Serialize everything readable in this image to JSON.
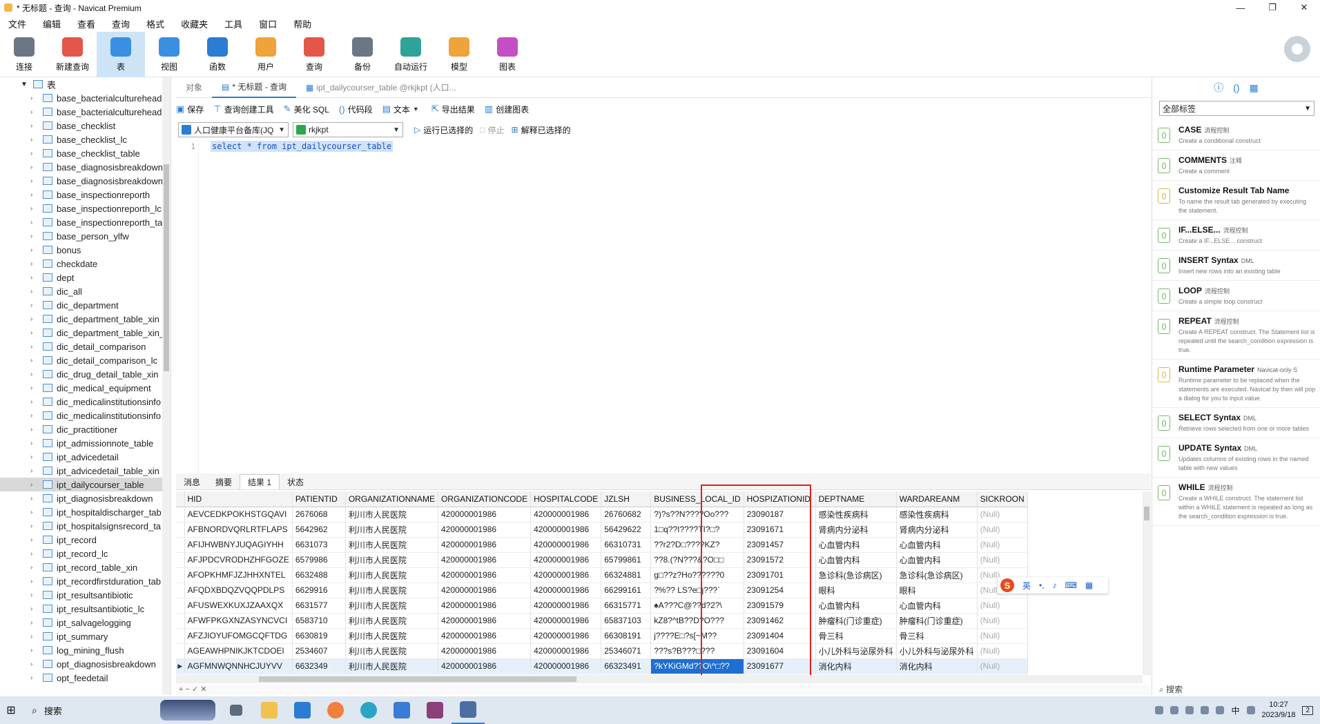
{
  "window": {
    "title": "* 无标题 - 查询 - Navicat Premium"
  },
  "menu": [
    "文件",
    "编辑",
    "查看",
    "查询",
    "格式",
    "收藏夹",
    "工具",
    "窗口",
    "帮助"
  ],
  "ribbon": [
    {
      "label": "连接",
      "icon": "plug-icon",
      "color": "#6b7785"
    },
    {
      "label": "新建查询",
      "icon": "new-query-icon",
      "color": "#e3564a"
    },
    {
      "label": "表",
      "icon": "table-icon",
      "color": "#3b8fe0"
    },
    {
      "label": "视图",
      "icon": "view-icon",
      "color": "#3b8fe0"
    },
    {
      "label": "函数",
      "icon": "function-icon",
      "color": "#2b7cd3"
    },
    {
      "label": "用户",
      "icon": "user-icon",
      "color": "#f0a23b"
    },
    {
      "label": "查询",
      "icon": "query-icon",
      "color": "#e3564a"
    },
    {
      "label": "备份",
      "icon": "backup-icon",
      "color": "#6b7785"
    },
    {
      "label": "自动运行",
      "icon": "robot-icon",
      "color": "#2fa39a"
    },
    {
      "label": "模型",
      "icon": "model-icon",
      "color": "#f0a23b"
    },
    {
      "label": "图表",
      "icon": "chart-icon",
      "color": "#c44fc4"
    }
  ],
  "sidebar": {
    "root": "表",
    "items": [
      "base_bacterialculturehead",
      "base_bacterialculturehead",
      "base_checklist",
      "base_checklist_lc",
      "base_checklist_table",
      "base_diagnosisbreakdown",
      "base_diagnosisbreakdown",
      "base_inspectionreporth",
      "base_inspectionreporth_lc",
      "base_inspectionreporth_ta",
      "base_person_ylfw",
      "bonus",
      "checkdate",
      "dept",
      "dic_all",
      "dic_department",
      "dic_department_table_xin",
      "dic_department_table_xin_",
      "dic_detail_comparison",
      "dic_detail_comparison_lc",
      "dic_drug_detail_table_xin",
      "dic_medical_equipment",
      "dic_medicalinstitutionsinfo",
      "dic_medicalinstitutionsinfo",
      "dic_practitioner",
      "ipt_admissionnote_table",
      "ipt_advicedetail",
      "ipt_advicedetail_table_xin",
      "ipt_dailycourser_table",
      "ipt_diagnosisbreakdown",
      "ipt_hospitaldischarger_tab",
      "ipt_hospitalsignsrecord_ta",
      "ipt_record",
      "ipt_record_lc",
      "ipt_record_table_xin",
      "ipt_recordfirstduration_tab",
      "ipt_resultsantibiotic",
      "ipt_resultsantibiotic_lc",
      "ipt_salvagelogging",
      "ipt_summary",
      "log_mining_flush",
      "opt_diagnosisbreakdown",
      "opt_feedetail"
    ],
    "selected_index": 28
  },
  "tabs": {
    "objects": "对象",
    "active": "* 无标题 - 查询",
    "other": "ipt_dailycourser_table @rkjkpt (人口..."
  },
  "toolbar1": {
    "save": "保存",
    "query_builder": "查询创建工具",
    "beautify": "美化 SQL",
    "snippet": "代码段",
    "text": "文本",
    "export": "导出结果",
    "create_chart": "创建图表"
  },
  "toolbar2": {
    "connection": "人口健康平台备库(JQ",
    "database": "rkjkpt",
    "run_selected": "运行已选择的",
    "stop": "停止",
    "explain": "解释已选择的"
  },
  "editor": {
    "line_number": "1",
    "sql": "select * from ipt_dailycourser_table"
  },
  "result_tabs": [
    "消息",
    "摘要",
    "结果 1",
    "状态"
  ],
  "grid": {
    "columns": [
      "HID",
      "PATIENTID",
      "ORGANIZATIONNAME",
      "ORGANIZATIONCODE",
      "HOSPITALCODE",
      "JZLSH",
      "BUSINESS_LOCAL_ID",
      "HOSPIZATIONID",
      "DEPTNAME",
      "WARDAREANM",
      "SICKROON"
    ],
    "rows": [
      [
        "AEVCEDKPOKHSTGQAVI",
        "2676068",
        "利川市人民医院",
        "420000001986",
        "420000001986",
        "26760682",
        "?)?s??N????Oo???",
        "23090187",
        "感染性疾病科",
        "感染性疾病科",
        "(Null)"
      ],
      [
        "AFBNORDVQRLRTFLAPS",
        "5642962",
        "利川市人民医院",
        "420000001986",
        "420000001986",
        "56429622",
        "1□q??I????TI?□?",
        "23091671",
        "肾病内分泌科",
        "肾病内分泌科",
        "(Null)"
      ],
      [
        "AFIJHWBNYJUQAGIYHH",
        "6631073",
        "利川市人民医院",
        "420000001986",
        "420000001986",
        "66310731",
        "??r2?D□????KZ?",
        "23091457",
        "心血管内科",
        "心血管内科",
        "(Null)"
      ],
      [
        "AFJPDCVRODHZHFGOZE",
        "6579986",
        "利川市人民医院",
        "420000001986",
        "420000001986",
        "65799861",
        "??8.(?N???&?O□□",
        "23091572",
        "心血管内科",
        "心血管内科",
        "(Null)"
      ],
      [
        "AFOPKHMFJZJHHXNTEL",
        "6632488",
        "利川市人民医院",
        "420000001986",
        "420000001986",
        "66324881",
        "g□??z?Ho??????0",
        "23091701",
        "急诊科(急诊病区)",
        "急诊科(急诊病区)",
        "(Null)"
      ],
      [
        "AFQDXBDQZVQQPDLPS",
        "6629916",
        "利川市人民医院",
        "420000001986",
        "420000001986",
        "66299161",
        "?%?? LS?e□j???`",
        "23091254",
        "眼科",
        "眼科",
        "(Null)"
      ],
      [
        "AFUSWEXKUXJZAAXQX",
        "6631577",
        "利川市人民医院",
        "420000001986",
        "420000001986",
        "66315771",
        "♠A???C@??d?2?\\",
        "23091579",
        "心血管内科",
        "心血管内科",
        "(Null)"
      ],
      [
        "AFWFPKGXNZASYNCVCI",
        "6583710",
        "利川市人民医院",
        "420000001986",
        "420000001986",
        "65837103",
        "kZ8?^tB??D?O???",
        "23091462",
        "肿瘤科(门诊重症)",
        "肿瘤科(门诊重症)",
        "(Null)"
      ],
      [
        "AFZJIOYUFOMGCQFTDG",
        "6630819",
        "利川市人民医院",
        "420000001986",
        "420000001986",
        "66308191",
        "j????E□?s[~M??",
        "23091404",
        "骨三科",
        "骨三科",
        "(Null)"
      ],
      [
        "AGEAWHPNIKJKTCDOEI",
        "2534607",
        "利川市人民医院",
        "420000001986",
        "420000001986",
        "25346071",
        "???s?B???□???",
        "23091604",
        "小儿外科与泌尿外科",
        "小儿外科与泌尿外科",
        "(Null)"
      ],
      [
        "AGFMNWQNNHCJUYVV",
        "6632349",
        "利川市人民医院",
        "420000001986",
        "420000001986",
        "66323491",
        "?kYKiGMd??O\\^□??",
        "23091677",
        "消化内科",
        "消化内科",
        "(Null)"
      ]
    ],
    "current_row": 10,
    "selected_column": 6
  },
  "right_panel": {
    "filter": "全部标签",
    "snippets": [
      {
        "title": "CASE",
        "tag": "流程控制",
        "desc": "Create a conditional construct",
        "color": "green"
      },
      {
        "title": "COMMENTS",
        "tag": "注释",
        "desc": "Create a comment",
        "color": "green"
      },
      {
        "title": "Customize Result Tab Name",
        "tag": "",
        "desc": "To name the result tab generated by executing the statement.",
        "color": "yellow"
      },
      {
        "title": "IF...ELSE...",
        "tag": "流程控制",
        "desc": "Create a IF...ELSE... construct",
        "color": "green"
      },
      {
        "title": "INSERT Syntax",
        "tag": "DML",
        "desc": "Insert new rows into an existing table",
        "color": "green"
      },
      {
        "title": "LOOP",
        "tag": "流程控制",
        "desc": "Create a simple loop construct",
        "color": "green"
      },
      {
        "title": "REPEAT",
        "tag": "流程控制",
        "desc": "Create A REPEAT construct. The Statement list is repeated until the search_condition expression is true.",
        "color": "green"
      },
      {
        "title": "Runtime Parameter",
        "tag": "Navicat-only S",
        "desc": "Runtime parameter to be replaced when the statements are executed. Navicat by then will pop a dialog for you to input value.",
        "color": "yellow"
      },
      {
        "title": "SELECT Syntax",
        "tag": "DML",
        "desc": "Retrieve rows selected from one or more tables",
        "color": "green"
      },
      {
        "title": "UPDATE Syntax",
        "tag": "DML",
        "desc": "Updates columns of existing rows in the named table with new values",
        "color": "green"
      },
      {
        "title": "WHILE",
        "tag": "流程控制",
        "desc": "Create a WHILE construct. The statement list within a WHILE statement is repeated as long as the search_condition expression is true.",
        "color": "green"
      }
    ],
    "search": "搜索"
  },
  "ime": {
    "lang": "英"
  },
  "taskbar": {
    "search": "搜索",
    "time": "10:27",
    "date": "2023/9/18",
    "lang": "中",
    "badge": "2"
  }
}
